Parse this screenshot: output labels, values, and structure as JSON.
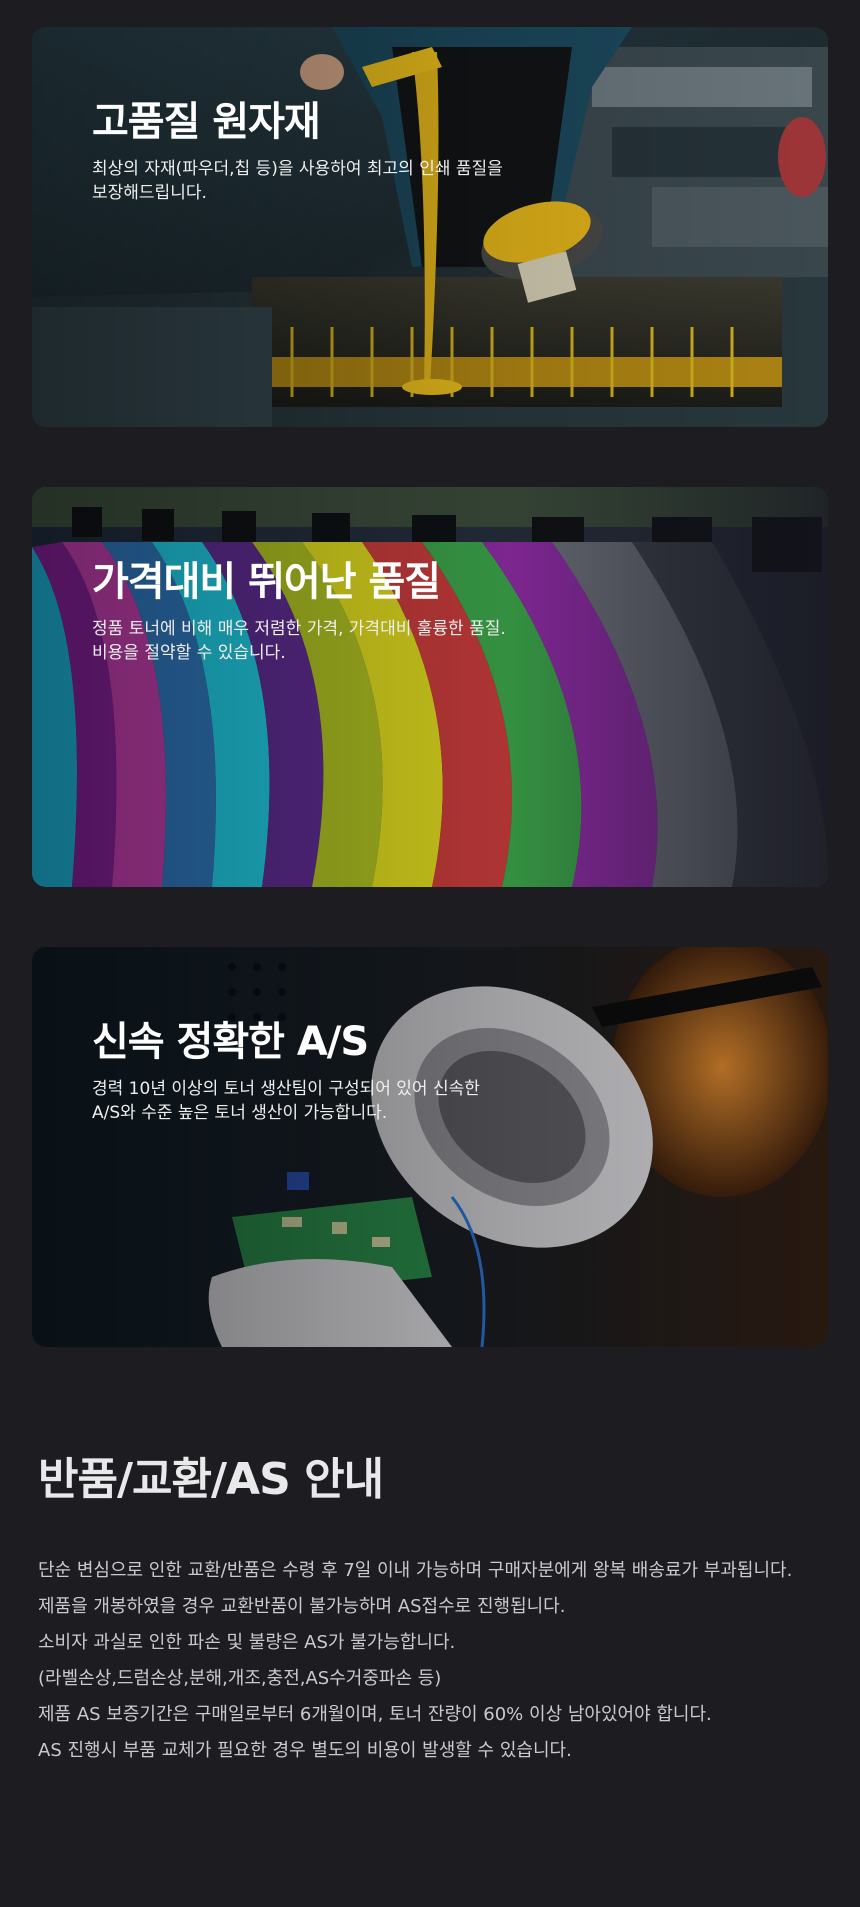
{
  "features": [
    {
      "title": "고품질 원자재",
      "description": "최상의 자재(파우더,칩 등)을 사용하여 최고의 인쇄 품질을 보장해드립니다.",
      "image": "toner-ink-pouring-photo"
    },
    {
      "title": "가격대비 뛰어난 품질",
      "description": "정품 토너에 비해 매우 저렴한 가격, 가격대비 훌륭한 품질. 비용을 절약할 수 있습니다.",
      "image": "color-print-stripes-photo"
    },
    {
      "title": "신속 정확한 A/S",
      "description": "경력 10년 이상의 토너 생산팀이 구성되어 있어 신속한 A/S와 수준 높은 토너 생산이 가능합니다.",
      "image": "technician-magnifier-photo"
    }
  ],
  "notice": {
    "title": "반품/교환/AS 안내",
    "lines": [
      "단순 변심으로 인한 교환/반품은 수령 후 7일 이내 가능하며 구매자분에게 왕복 배송료가 부과됩니다.",
      "제품을 개봉하였을 경우 교환반품이 불가능하며 AS접수로 진행됩니다.",
      "소비자 과실로 인한 파손 및 불량은 AS가 불가능합니다.",
      "(라벨손상,드럼손상,분해,개조,충전,AS수거중파손 등)",
      "제품 AS 보증기간은 구매일로부터 6개월이며, 토너 잔량이 60% 이상 남아있어야 합니다.",
      "AS 진행시 부품 교체가 필요한 경우 별도의 비용이 발생할 수 있습니다."
    ]
  },
  "colors": {
    "page_background": "#1d1d21",
    "title_text": "#ffffff",
    "notice_text": "#c9c9cf"
  }
}
